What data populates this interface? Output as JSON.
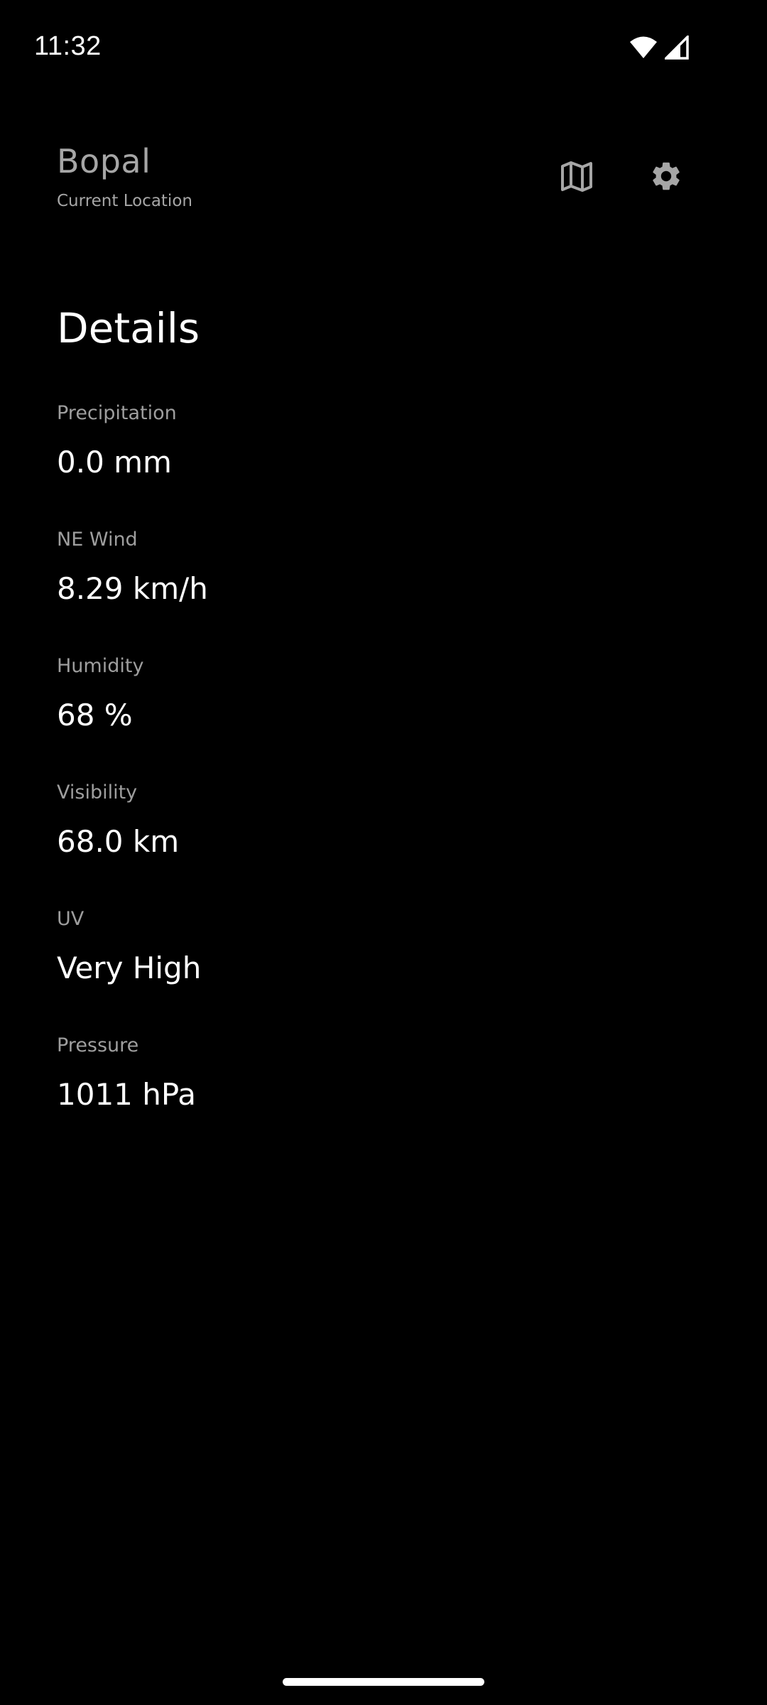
{
  "status_bar": {
    "time": "11:32",
    "icons": [
      "wifi-icon",
      "cellular-signal-icon"
    ]
  },
  "header": {
    "location_name": "Bopal",
    "location_subtitle": "Current Location",
    "actions": [
      {
        "icon": "map-icon"
      },
      {
        "icon": "gear-icon"
      }
    ]
  },
  "details": {
    "title": "Details",
    "items": [
      {
        "label": "Precipitation",
        "value": "0.0 mm"
      },
      {
        "label": "NE Wind",
        "value": "8.29 km/h"
      },
      {
        "label": "Humidity",
        "value": "68 %"
      },
      {
        "label": "Visibility",
        "value": "68.0 km"
      },
      {
        "label": "UV",
        "value": "Very High"
      },
      {
        "label": "Pressure",
        "value": "1011 hPa"
      }
    ]
  },
  "colors": {
    "background": "#000000",
    "primary_text": "#ffffff",
    "secondary_text": "#a6a6a6",
    "icon": "#a6a6a6"
  }
}
